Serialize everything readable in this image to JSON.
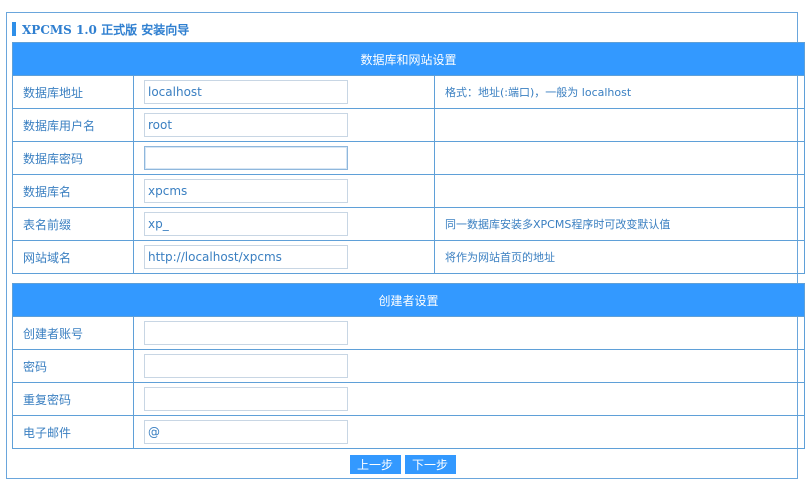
{
  "title": "XPCMS 1.0 正式版 安装向导",
  "db_section": {
    "heading": "数据库和网站设置",
    "rows": [
      {
        "label": "数据库地址",
        "value": "localhost",
        "hint": "格式：地址(:端口)，一般为 localhost"
      },
      {
        "label": "数据库用户名",
        "value": "root",
        "hint": ""
      },
      {
        "label": "数据库密码",
        "value": "",
        "hint": ""
      },
      {
        "label": "数据库名",
        "value": "xpcms",
        "hint": ""
      },
      {
        "label": "表名前缀",
        "value": "xp_",
        "hint": "同一数据库安装多XPCMS程序时可改变默认值"
      },
      {
        "label": "网站域名",
        "value": "http://localhost/xpcms",
        "hint": "将作为网站首页的地址"
      }
    ]
  },
  "admin_section": {
    "heading": "创建者设置",
    "rows": [
      {
        "label": "创建者账号",
        "value": ""
      },
      {
        "label": "密码",
        "value": ""
      },
      {
        "label": "重复密码",
        "value": ""
      },
      {
        "label": "电子邮件",
        "value": "@"
      }
    ]
  },
  "buttons": {
    "prev": "上一步",
    "next": "下一步"
  }
}
